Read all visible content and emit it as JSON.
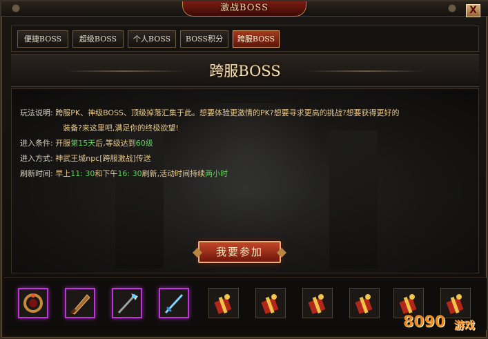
{
  "window": {
    "title": "激战BOSS",
    "close_label": "X"
  },
  "tabs": [
    {
      "label": "便捷BOSS",
      "active": false
    },
    {
      "label": "超级BOSS",
      "active": false
    },
    {
      "label": "个人BOSS",
      "active": false
    },
    {
      "label": "BOSS积分",
      "active": false
    },
    {
      "label": "跨服BOSS",
      "active": true
    }
  ],
  "banner": {
    "title": "跨服BOSS"
  },
  "info": {
    "gameplay": {
      "label": "玩法说明:",
      "line1": "跨服PK、神级BOSS、顶级掉落汇集于此。想要体验更激情的PK?想要寻求更高的挑战?想要获得更好的",
      "line2": "装备?来这里吧,满足你的终极欲望!"
    },
    "condition": {
      "label": "进入条件:",
      "pre": "开服",
      "day": "第15天",
      "mid": "后,等级达到",
      "level": "60级"
    },
    "method": {
      "label": "进入方式:",
      "text": "神武王城npc[跨服激战]传送"
    },
    "refresh": {
      "label": "刷新时间:",
      "pre": "早上",
      "t1": "11: 30",
      "mid": "和下午",
      "t2": "16: 30",
      "mid2": "刷新,活动时间持续",
      "dur": "两小时"
    }
  },
  "join_button": "我要参加",
  "rewards": [
    {
      "icon": "ring-icon",
      "rarity": "purple"
    },
    {
      "icon": "blade-icon",
      "rarity": "purple"
    },
    {
      "icon": "staff-icon",
      "rarity": "purple"
    },
    {
      "icon": "sword-icon",
      "rarity": "purple"
    },
    {
      "icon": "gift-box-icon",
      "rarity": "normal"
    },
    {
      "icon": "gift-box-icon",
      "rarity": "normal"
    },
    {
      "icon": "gift-box-icon",
      "rarity": "normal"
    },
    {
      "icon": "gift-box-icon",
      "rarity": "normal"
    },
    {
      "icon": "gift-box-icon",
      "rarity": "normal"
    },
    {
      "icon": "gift-box-icon",
      "rarity": "normal"
    }
  ],
  "watermark": {
    "num": "8090",
    "cn": "游戏"
  },
  "colors": {
    "highlight": "#5fd35a",
    "text": "#e8c98a",
    "active_tab": "#a53a1e",
    "epic_border": "#c037d8"
  }
}
